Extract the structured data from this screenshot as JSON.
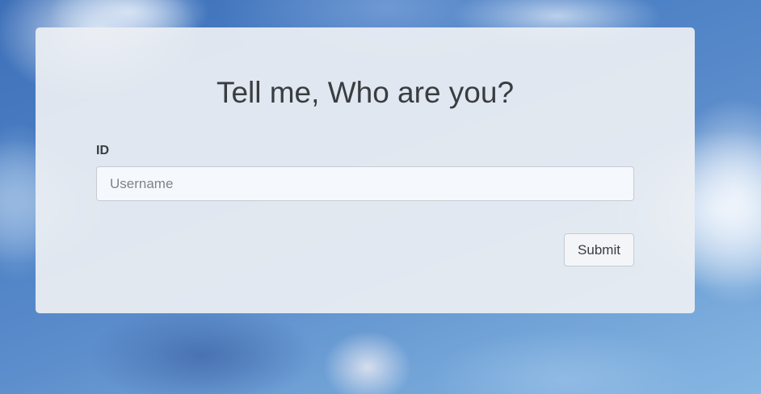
{
  "form": {
    "title": "Tell me, Who are you?",
    "id_label": "ID",
    "username_placeholder": "Username",
    "username_value": "",
    "submit_label": "Submit"
  },
  "colors": {
    "card_background": "#eceff3",
    "text": "#3a3d40",
    "input_border": "#c7ccd2",
    "sky_blue": "#4a7fc4"
  }
}
